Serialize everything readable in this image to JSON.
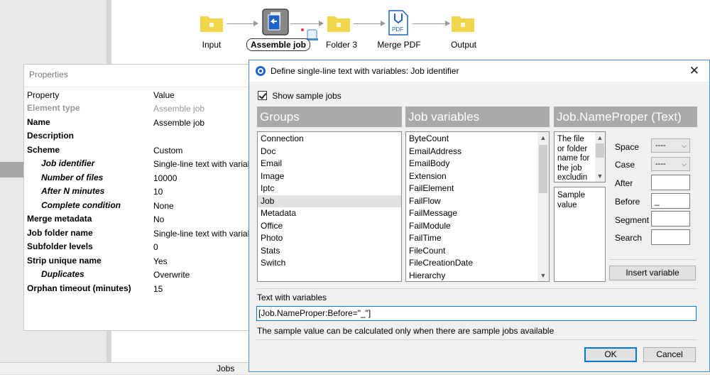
{
  "flow": {
    "nodes": [
      {
        "label": "Input",
        "icon": "folder-icon"
      },
      {
        "label": "Assemble job",
        "icon": "assemble-job-icon"
      },
      {
        "label": "Folder 3",
        "icon": "folder-icon"
      },
      {
        "label": "Merge PDF",
        "icon": "pdf-icon"
      },
      {
        "label": "Output",
        "icon": "folder-icon"
      }
    ]
  },
  "bottom_bar": {
    "label": "Jobs"
  },
  "properties": {
    "title": "Properties",
    "col_property": "Property",
    "col_value": "Value",
    "rows": [
      {
        "key": "Element type",
        "value": "Assemble job"
      },
      {
        "key": "Name",
        "value": "Assemble job"
      },
      {
        "key": "Description",
        "value": ""
      },
      {
        "key": "Scheme",
        "value": "Custom"
      },
      {
        "key": "Job identifier",
        "value": "Single-line text with variables"
      },
      {
        "key": "Number of files",
        "value": "10000"
      },
      {
        "key": "After N minutes",
        "value": "10"
      },
      {
        "key": "Complete condition",
        "value": "None"
      },
      {
        "key": "Merge metadata",
        "value": "No"
      },
      {
        "key": "Job folder name",
        "value": "Single-line text with variables"
      },
      {
        "key": "Subfolder levels",
        "value": "0"
      },
      {
        "key": "Strip unique name",
        "value": "Yes"
      },
      {
        "key": "Duplicates",
        "value": "Overwrite"
      },
      {
        "key": "Orphan timeout (minutes)",
        "value": "15"
      }
    ]
  },
  "dialog": {
    "title": "Define single-line text with variables: Job identifier",
    "show_sample_jobs": "Show sample jobs",
    "groups_header": "Groups",
    "variables_header": "Job variables",
    "detail_header": "Job.NameProper (Text)",
    "groups": [
      "Connection",
      "Doc",
      "Email",
      "Image",
      "Iptc",
      "Job",
      "Metadata",
      "Office",
      "Photo",
      "Stats",
      "Switch"
    ],
    "selected_group": "Job",
    "variables": [
      "ByteCount",
      "EmailAddress",
      "EmailBody",
      "Extension",
      "FailElement",
      "FailFlow",
      "FailMessage",
      "FailModule",
      "FailTime",
      "FileCount",
      "FileCreationDate",
      "Hierarchy"
    ],
    "description": "The file or folder name for the job excludin",
    "sample_value": "Sample value",
    "labels": {
      "space": "Space",
      "case": "Case",
      "after": "After",
      "before": "Before",
      "segment": "Segment",
      "search": "Search"
    },
    "space_value": "----",
    "case_value": "----",
    "after_value": "",
    "before_value": "_",
    "segment_value": "",
    "search_value": "",
    "insert_variable": "Insert variable",
    "text_with_variables_label": "Text with variables",
    "text_value": "[Job.NameProper:Before=\"_\"]",
    "hint": "The sample value can be calculated only when there are sample jobs available",
    "ok": "OK",
    "cancel": "Cancel"
  },
  "colors": {
    "folder": "#f0d64a",
    "selection_border": "#0078d7",
    "column_header": "#a9a9a9"
  }
}
